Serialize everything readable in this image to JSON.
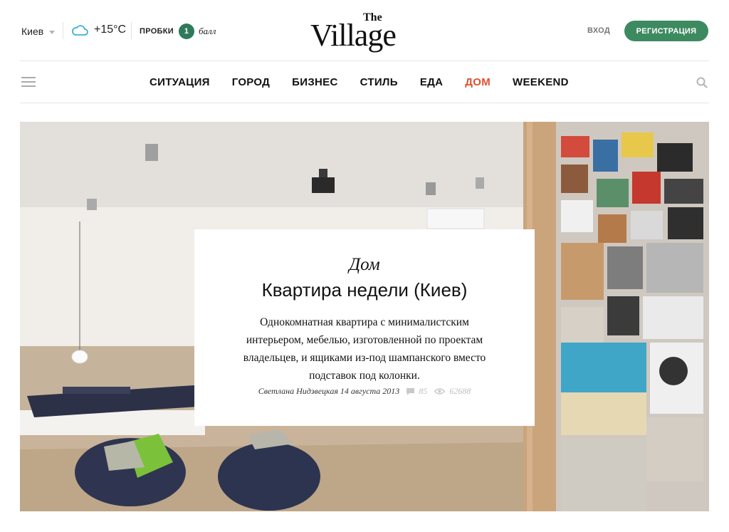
{
  "header": {
    "city": "Киев",
    "temperature": "+15°C",
    "traffic_label": "Пробки",
    "traffic_score": "1",
    "traffic_unit": "балл",
    "logo_the": "The",
    "logo_village": "Village",
    "login_label": "Вход",
    "register_label": "Регистрация",
    "accent_color": "#3d8a61",
    "icons": [
      "chevron-down-icon",
      "cloud-icon",
      "search-icon",
      "menu-icon"
    ]
  },
  "nav": {
    "items": [
      {
        "label": "Ситуация",
        "active": false
      },
      {
        "label": "Город",
        "active": false
      },
      {
        "label": "Бизнес",
        "active": false
      },
      {
        "label": "Стиль",
        "active": false
      },
      {
        "label": "Еда",
        "active": false
      },
      {
        "label": "Дом",
        "active": true
      },
      {
        "label": "Weekend",
        "active": false
      }
    ],
    "active_color": "#e0502e"
  },
  "feature": {
    "rubric": "Дом",
    "title": "Квартира недели (Киев)",
    "lead": "Однокомнатная квартира с минималистским интерьером, мебелью, изготовленной по проектам владельцев, и ящиками из-под шампанского вместо подставок под колонки.",
    "author_date": "Светлана Нидзвецкая 14 августа 2013",
    "comments": "85",
    "views": "62688"
  }
}
